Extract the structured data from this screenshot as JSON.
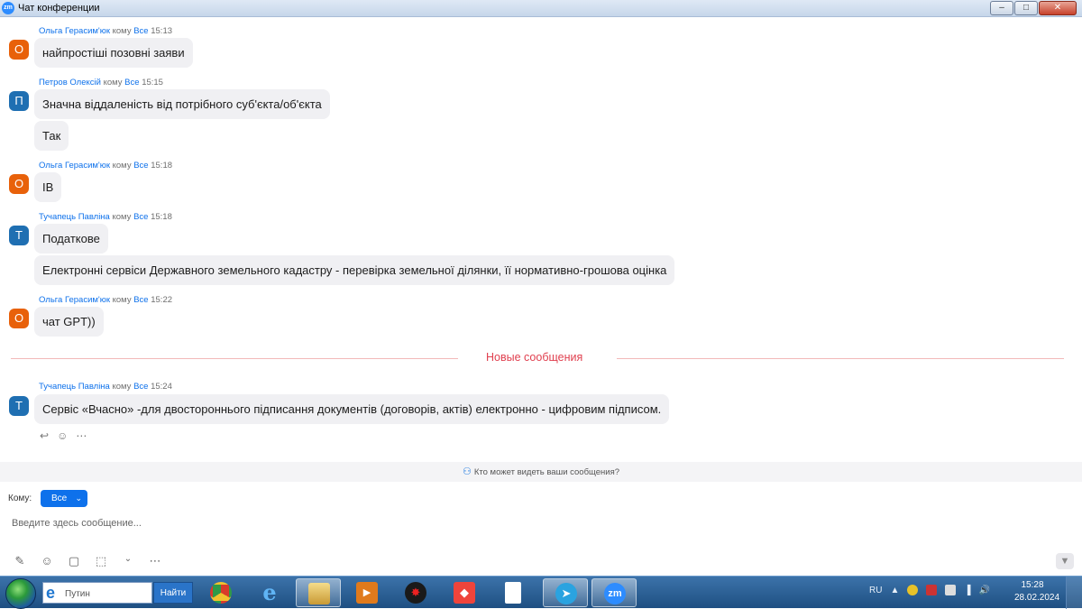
{
  "window": {
    "app_icon": "zm",
    "title": "Чат конференции"
  },
  "messages": [
    {
      "avatar": "О",
      "avatar_color": "#e8610a",
      "sender": "Ольга Герасим'юк",
      "to_word": "кому",
      "recipient": "Все",
      "time": "15:13",
      "texts": [
        "найпростіші позовні заяви"
      ]
    },
    {
      "avatar": "П",
      "avatar_color": "#1f6fb2",
      "sender": "Петров Олексій",
      "to_word": "кому",
      "recipient": "Все",
      "time": "15:15",
      "texts": [
        "Значна віддаленість від потрібного суб'єкта/об'єкта",
        "Так"
      ]
    },
    {
      "avatar": "О",
      "avatar_color": "#e8610a",
      "sender": "Ольга Герасим'юк",
      "to_word": "кому",
      "recipient": "Все",
      "time": "15:18",
      "texts": [
        "ІВ"
      ]
    },
    {
      "avatar": "Т",
      "avatar_color": "#1f6fb2",
      "sender": "Тучапець Павліна",
      "to_word": "кому",
      "recipient": "Все",
      "time": "15:18",
      "texts": [
        "Податкове",
        "Електронні сервіси Державного земельного кадастру - перевірка земельної ділянки, її нормативно-грошова оцінка"
      ]
    },
    {
      "avatar": "О",
      "avatar_color": "#e8610a",
      "sender": "Ольга Герасим'юк",
      "to_word": "кому",
      "recipient": "Все",
      "time": "15:22",
      "texts": [
        "чат GPT))"
      ]
    },
    {
      "avatar": "Т",
      "avatar_color": "#1f6fb2",
      "sender": "Тучапець Павліна",
      "to_word": "кому",
      "recipient": "Все",
      "time": "15:24",
      "texts": [
        "Сервіс «Вчасно» -для двостороннього підписання документів (договорів, актів) електронно - цифровим підписом."
      ]
    }
  ],
  "new_messages_label": "Новые сообщения",
  "reactions": [
    "reply-icon",
    "emoji-icon",
    "more-icon"
  ],
  "privacy_notice": "Кто может видеть ваши сообщения?",
  "composer": {
    "to_label": "Кому:",
    "to_value": "Все",
    "placeholder": "Введите здесь сообщение..."
  },
  "composer_toolbar": [
    "format-icon",
    "emoji-icon",
    "file-icon",
    "screenshot-icon",
    "chevron-down-icon",
    "more-icon"
  ],
  "taskbar": {
    "search_value": "Путин",
    "search_button": "Найти",
    "apps": [
      {
        "name": "chrome",
        "color": "#e9a321"
      },
      {
        "name": "internet-explorer",
        "color": "#2f8fe0"
      },
      {
        "name": "file-explorer",
        "color": "#e8c66a",
        "active": true
      },
      {
        "name": "media-player",
        "color": "#e07a1c"
      },
      {
        "name": "red-app",
        "color": "#d61f1f"
      },
      {
        "name": "anydesk",
        "color": "#ef443b"
      },
      {
        "name": "document",
        "color": "#ffffff"
      },
      {
        "name": "telegram",
        "color": "#2aa3e0",
        "active": true
      },
      {
        "name": "zoom",
        "color": "#2d8cff",
        "label": "zm",
        "active": true
      }
    ],
    "tray_lang": "RU",
    "time": "15:28",
    "date": "28.02.2024"
  }
}
